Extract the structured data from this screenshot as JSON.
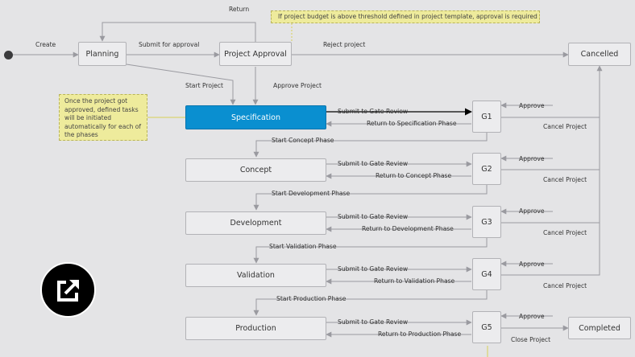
{
  "states": {
    "planning": "Planning",
    "project_approval": "Project Approval",
    "cancelled": "Cancelled",
    "specification": "Specification",
    "concept": "Concept",
    "development": "Development",
    "validation": "Validation",
    "production": "Production",
    "completed": "Completed"
  },
  "gates": [
    "G1",
    "G2",
    "G3",
    "G4",
    "G5"
  ],
  "transitions": {
    "create": "Create",
    "submit_for_approval": "Submit for approval",
    "return": "Return",
    "reject_project": "Reject project",
    "start_project": "Start Project",
    "approve_project": "Approve Project",
    "submit_to_gate_review": "Submit to Gate Review",
    "return_to_specification": "Return to Specification Phase",
    "return_to_concept": "Return to Concept Phase",
    "return_to_development": "Return to Development Phase",
    "return_to_validation": "Return to Validation Phase",
    "return_to_production": "Return to Production Phase",
    "start_concept": "Start Concept Phase",
    "start_development": "Start Development Phase",
    "start_validation": "Start Validation Phase",
    "start_production": "Start Production Phase",
    "approve": "Approve",
    "cancel_project": "Cancel Project",
    "close_project": "Close Project"
  },
  "notes": {
    "budget": "If project budget is above threshold defined in project template, approval is required",
    "tasks": "Once the project got\napproved, defined tasks\nwill be initiated\nautomatically for each of\nthe phases"
  },
  "colors": {
    "background": "#e4e4e6",
    "active_state": "#0a8fd0",
    "note": "#eeeb9c",
    "connector": "#9a9aa0",
    "active_connector": "#000000"
  },
  "icons": {
    "badge": "external-link-icon"
  }
}
